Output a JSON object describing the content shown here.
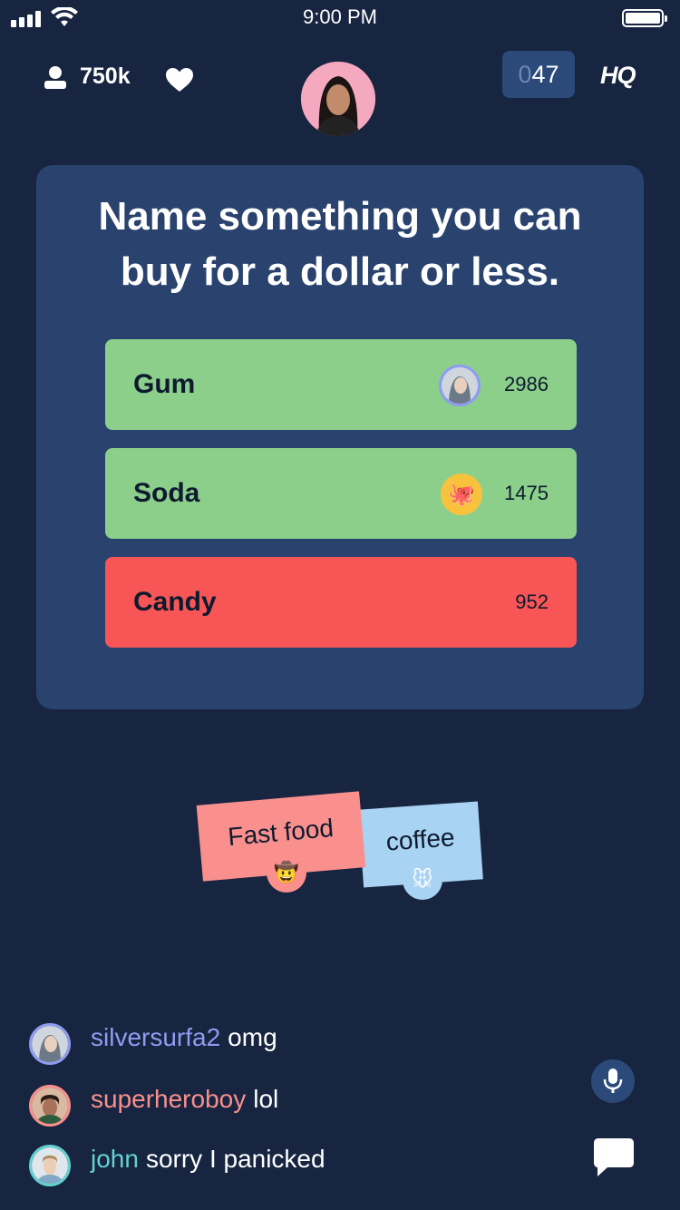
{
  "status_bar": {
    "time": "9:00 PM"
  },
  "header": {
    "viewer_count": "750k",
    "timer_dim": "0",
    "timer_value": "47",
    "logo": "HQ"
  },
  "question": {
    "line1": "Name something you can",
    "line2": "buy for a dollar or less."
  },
  "answers": [
    {
      "label": "Gum",
      "count": "2986",
      "state": "correct",
      "color": "#8ccf8b",
      "avatar": "user-photo"
    },
    {
      "label": "Soda",
      "count": "1475",
      "state": "correct",
      "color": "#8ccf8b",
      "avatar": "octopus-emoji"
    },
    {
      "label": "Candy",
      "count": "952",
      "state": "wrong",
      "color": "#f85656",
      "avatar": ""
    }
  ],
  "floating_answers": [
    {
      "text": "Fast food",
      "emoji": "🤠",
      "color": "#f9908d"
    },
    {
      "text": "coffee",
      "emoji": "🐭",
      "color": "#a9d3f2"
    }
  ],
  "chat": [
    {
      "user": "silversurfa2",
      "message": "omg",
      "user_color": "#8e9cf2"
    },
    {
      "user": "superheroboy",
      "message": "lol",
      "user_color": "#f9908d"
    },
    {
      "user": "john",
      "message": "sorry I panicked",
      "user_color": "#63d1d1"
    }
  ],
  "icons": {
    "mic": "microphone-icon",
    "chat": "chat-bubble-icon",
    "viewers": "person-icon",
    "heart": "heart-icon"
  }
}
